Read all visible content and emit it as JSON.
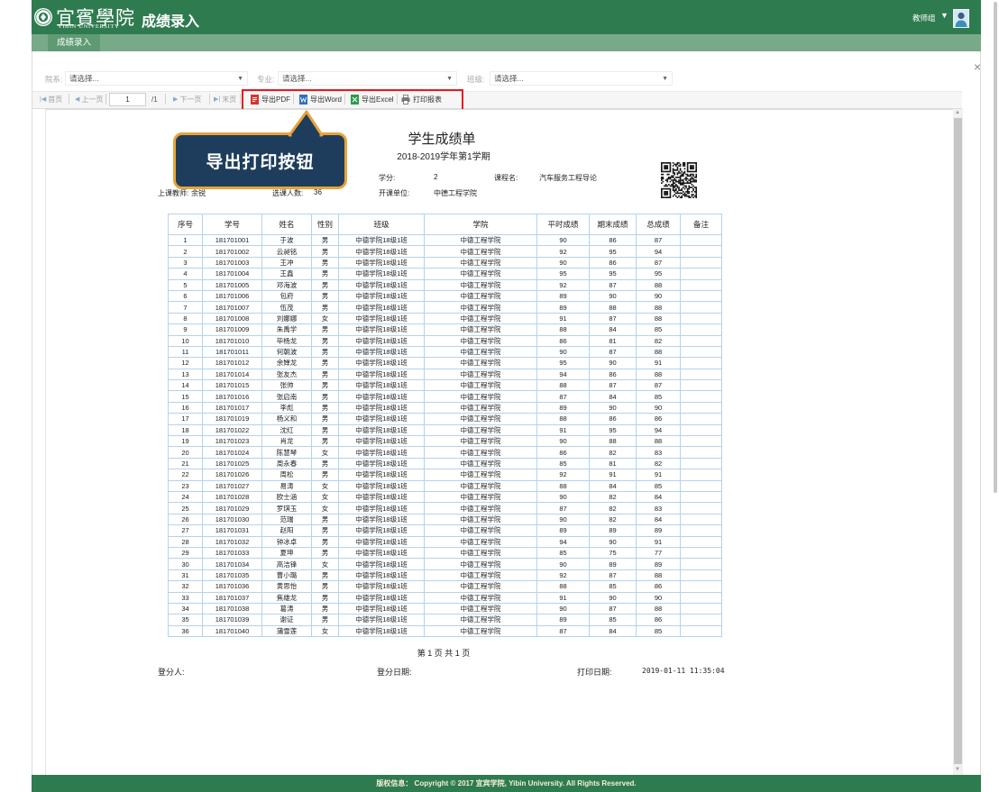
{
  "colors": {
    "header_bg": "#2e7b4f",
    "tabbar_bg": "#78aa89",
    "tab_active_bg": "#5f9a73",
    "highlight_border": "#e8191f",
    "callout_bg": "#1e3d5c",
    "callout_border": "#e8a33a",
    "table_border": "#b7d2ea"
  },
  "header": {
    "logo_chinese": "宜賓學院",
    "logo_english": "YIBIN UNIVERSITY",
    "app_title": "成绩录入",
    "user_role": "教师组",
    "emblem_icon": "university-emblem-icon",
    "avatar_icon": "user-avatar-icon"
  },
  "tabs": [
    {
      "label": "成绩录入",
      "active": true
    }
  ],
  "filters": {
    "department": {
      "label": "院系:",
      "value": "请选择..."
    },
    "major": {
      "label": "专业:",
      "value": "请选择..."
    },
    "class": {
      "label": "班级:",
      "value": "请选择..."
    }
  },
  "toolbar": {
    "first_page": "首页",
    "prev_page": "上一页",
    "page_input": "1",
    "page_total": "/1",
    "next_page": "下一页",
    "last_page": "末页",
    "export_pdf": "导出PDF",
    "export_word": "导出Word",
    "export_excel": "导出Excel",
    "print_report": "打印报表"
  },
  "callout": {
    "text": "导出打印按钮"
  },
  "report": {
    "title": "学生成绩单",
    "term": "2018-2019学年第1学期",
    "info": {
      "credit_label": "学分:",
      "credit": "2",
      "course_label": "课程名:",
      "course": "汽车服务工程导论",
      "teacher_label": "上课教师:",
      "teacher": "余锐",
      "enrolled_label": "选课人数:",
      "enrolled": "36",
      "dept_label": "开课单位:",
      "dept": "中德工程学院"
    },
    "table": {
      "columns": [
        "序号",
        "学号",
        "姓名",
        "性别",
        "班级",
        "学院",
        "平时成绩",
        "期末成绩",
        "总成绩",
        "备注"
      ],
      "rows": [
        [
          "1",
          "181701001",
          "于波",
          "男",
          "中德学院18级1班",
          "中德工程学院",
          "90",
          "86",
          "87",
          ""
        ],
        [
          "2",
          "181701002",
          "云昶铭",
          "男",
          "中德学院18级1班",
          "中德工程学院",
          "92",
          "95",
          "94",
          ""
        ],
        [
          "3",
          "181701003",
          "王冲",
          "男",
          "中德学院18级1班",
          "中德工程学院",
          "90",
          "86",
          "87",
          ""
        ],
        [
          "4",
          "181701004",
          "王鑫",
          "男",
          "中德学院18级1班",
          "中德工程学院",
          "95",
          "95",
          "95",
          ""
        ],
        [
          "5",
          "181701005",
          "邓海波",
          "男",
          "中德学院18级1班",
          "中德工程学院",
          "92",
          "87",
          "88",
          ""
        ],
        [
          "6",
          "181701006",
          "包府",
          "男",
          "中德学院18级1班",
          "中德工程学院",
          "89",
          "90",
          "90",
          ""
        ],
        [
          "7",
          "181701007",
          "伍茂",
          "男",
          "中德学院18级1班",
          "中德工程学院",
          "89",
          "88",
          "88",
          ""
        ],
        [
          "8",
          "181701008",
          "刘娜娜",
          "女",
          "中德学院18级1班",
          "中德工程学院",
          "91",
          "87",
          "88",
          ""
        ],
        [
          "9",
          "181701009",
          "朱禹学",
          "男",
          "中德学院18级1班",
          "中德工程学院",
          "88",
          "84",
          "85",
          ""
        ],
        [
          "10",
          "181701010",
          "毕杨龙",
          "男",
          "中德学院18级1班",
          "中德工程学院",
          "86",
          "81",
          "82",
          ""
        ],
        [
          "11",
          "181701011",
          "何朝波",
          "男",
          "中德学院18级1班",
          "中德工程学院",
          "90",
          "87",
          "88",
          ""
        ],
        [
          "12",
          "181701012",
          "余婵龙",
          "男",
          "中德学院18级1班",
          "中德工程学院",
          "95",
          "90",
          "91",
          ""
        ],
        [
          "13",
          "181701014",
          "张友杰",
          "男",
          "中德学院18级1班",
          "中德工程学院",
          "94",
          "86",
          "88",
          ""
        ],
        [
          "14",
          "181701015",
          "张帅",
          "男",
          "中德学院18级1班",
          "中德工程学院",
          "88",
          "87",
          "87",
          ""
        ],
        [
          "15",
          "181701016",
          "张启南",
          "男",
          "中德学院18级1班",
          "中德工程学院",
          "87",
          "84",
          "85",
          ""
        ],
        [
          "16",
          "181701017",
          "李彪",
          "男",
          "中德学院18级1班",
          "中德工程学院",
          "89",
          "90",
          "90",
          ""
        ],
        [
          "17",
          "181701019",
          "杨义和",
          "男",
          "中德学院18级1班",
          "中德工程学院",
          "88",
          "86",
          "86",
          ""
        ],
        [
          "18",
          "181701022",
          "沈红",
          "男",
          "中德学院18级1班",
          "中德工程学院",
          "91",
          "95",
          "94",
          ""
        ],
        [
          "19",
          "181701023",
          "肖龙",
          "男",
          "中德学院18级1班",
          "中德工程学院",
          "90",
          "88",
          "88",
          ""
        ],
        [
          "20",
          "181701024",
          "陈慧琴",
          "女",
          "中德学院18级1班",
          "中德工程学院",
          "86",
          "82",
          "83",
          ""
        ],
        [
          "21",
          "181701025",
          "周永春",
          "男",
          "中德学院18级1班",
          "中德工程学院",
          "85",
          "81",
          "82",
          ""
        ],
        [
          "22",
          "181701026",
          "周松",
          "男",
          "中德学院18级1班",
          "中德工程学院",
          "92",
          "91",
          "91",
          ""
        ],
        [
          "23",
          "181701027",
          "易涛",
          "女",
          "中德学院18级1班",
          "中德工程学院",
          "88",
          "84",
          "85",
          ""
        ],
        [
          "24",
          "181701028",
          "欧士涵",
          "女",
          "中德学院18级1班",
          "中德工程学院",
          "90",
          "82",
          "84",
          ""
        ],
        [
          "25",
          "181701029",
          "罗琪玉",
          "女",
          "中德学院18级1班",
          "中德工程学院",
          "87",
          "82",
          "83",
          ""
        ],
        [
          "26",
          "181701030",
          "范瑞",
          "男",
          "中德学院18级1班",
          "中德工程学院",
          "90",
          "82",
          "84",
          ""
        ],
        [
          "27",
          "181701031",
          "赵阳",
          "男",
          "中德学院18级1班",
          "中德工程学院",
          "89",
          "89",
          "89",
          ""
        ],
        [
          "28",
          "181701032",
          "钟冰卓",
          "男",
          "中德学院18级1班",
          "中德工程学院",
          "94",
          "90",
          "91",
          ""
        ],
        [
          "29",
          "181701033",
          "夏坤",
          "男",
          "中德学院18级1班",
          "中德工程学院",
          "85",
          "75",
          "77",
          ""
        ],
        [
          "30",
          "181701034",
          "高洁锋",
          "女",
          "中德学院18级1班",
          "中德工程学院",
          "90",
          "89",
          "89",
          ""
        ],
        [
          "31",
          "181701035",
          "曹小璐",
          "男",
          "中德学院18级1班",
          "中德工程学院",
          "92",
          "87",
          "88",
          ""
        ],
        [
          "32",
          "181701036",
          "黄思怡",
          "男",
          "中德学院18级1班",
          "中德工程学院",
          "88",
          "85",
          "86",
          ""
        ],
        [
          "33",
          "181701037",
          "焦雄龙",
          "男",
          "中德学院18级1班",
          "中德工程学院",
          "91",
          "90",
          "90",
          ""
        ],
        [
          "34",
          "181701038",
          "葛涛",
          "男",
          "中德学院18级1班",
          "中德工程学院",
          "90",
          "87",
          "88",
          ""
        ],
        [
          "35",
          "181701039",
          "谢证",
          "男",
          "中德学院18级1班",
          "中德工程学院",
          "89",
          "85",
          "86",
          ""
        ],
        [
          "36",
          "181701040",
          "蒲雪莲",
          "女",
          "中德学院18级1班",
          "中德工程学院",
          "87",
          "84",
          "85",
          ""
        ]
      ]
    },
    "page_indicator": "第 1 页 共 1 页",
    "signer_label": "登分人:",
    "sign_date_label": "登分日期:",
    "print_date_label": "打印日期:",
    "print_date": "2019-01-11 11:35:04"
  },
  "footer": {
    "copyright": "版权信息： Copyright © 2017 宜宾学院, Yibin University. All Rights Reserved."
  }
}
